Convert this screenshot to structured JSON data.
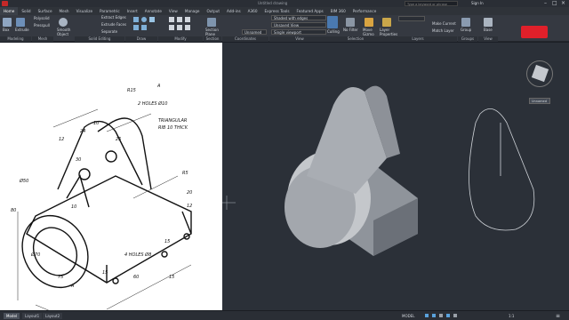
{
  "title_bar": {
    "doc_title": "Untitled drawing",
    "search_placeholder": "Type a keyword or phrase",
    "sign_in": "Sign In"
  },
  "tabs": [
    "Home",
    "Solid",
    "Surface",
    "Mesh",
    "Visualize",
    "Parametric",
    "Insert",
    "Annotate",
    "View",
    "Manage",
    "Output",
    "Add-ins",
    "A360",
    "Express Tools",
    "Featured Apps",
    "BIM 360",
    "Performance"
  ],
  "ribbon": {
    "box": "Box",
    "extrude": "Extrude",
    "polysolid": "Polysolid",
    "presspull": "Presspull",
    "smooth_object": "Smooth Object",
    "extract_edges": "Extract Edges",
    "extrude_faces": "Extrude Faces",
    "separate": "Separate",
    "section_plane": "Section Plane",
    "visual_style": "Shaded with edges",
    "view_name": "Unsaved View",
    "world": "Unnamed",
    "viewport_config": "Single viewport",
    "culling": "Culling",
    "no_filter": "No Filter",
    "move_gizmo": "Move Gizmo",
    "layer_properties": "Layer Properties",
    "make_current": "Make Current",
    "match_layer": "Match Layer",
    "group": "Group",
    "base": "Base",
    "panels": [
      "Modeling",
      "Mesh",
      "Solid Editing",
      "Draw",
      "Modify",
      "Section",
      "Coordinates",
      "View",
      "Selection",
      "Layers",
      "Groups",
      "View"
    ]
  },
  "drawing": {
    "dims": [
      "12",
      "24",
      "10",
      "R15",
      "A",
      "2 HOLES Ø10",
      "TRIANGULAR",
      "RIB 10 THICK",
      "25",
      "30",
      "10",
      "Ø50",
      "R5",
      "20",
      "12",
      "60",
      "15",
      "Ø70",
      "4 HOLES Ø8",
      "15",
      "75",
      "80",
      "A",
      "15"
    ]
  },
  "viewcube": {
    "label": "Unnamed"
  },
  "status": {
    "tabs": [
      "Model",
      "Layout1",
      "Layout2"
    ],
    "mode": "MODEL",
    "scale": "1:1"
  },
  "colors": {
    "ribbon": "#353941",
    "viewport": "#2b3038",
    "accent_red": "#e0202a"
  }
}
